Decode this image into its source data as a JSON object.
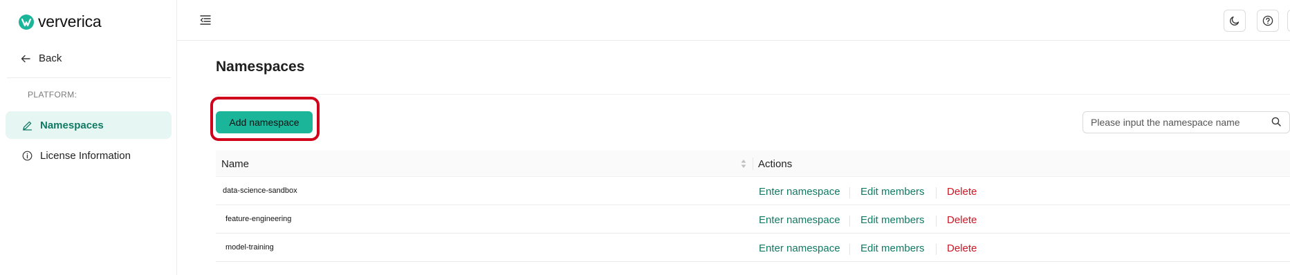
{
  "sidebar": {
    "brand": "ververica",
    "back_label": "Back",
    "section_label": "PLATFORM:",
    "items": [
      {
        "label": "Namespaces",
        "icon": "pencil-icon",
        "active": true
      },
      {
        "label": "License Information",
        "icon": "info-icon",
        "active": false
      }
    ]
  },
  "topbar": {
    "icons": [
      "collapse-menu-icon",
      "moon-icon",
      "help-icon"
    ]
  },
  "main": {
    "title": "Namespaces",
    "add_button_label": "Add namespace",
    "search": {
      "placeholder": "Please input the namespace name"
    },
    "table": {
      "columns": [
        "Name",
        "Actions"
      ],
      "rows": [
        {
          "name": "data-science-sandbox"
        },
        {
          "name": "feature-engineering"
        },
        {
          "name": "model-training"
        }
      ],
      "actions": {
        "enter": "Enter namespace",
        "edit": "Edit members",
        "delete": "Delete"
      }
    }
  },
  "colors": {
    "accent": "#1bb59a",
    "link": "#0f7a64",
    "danger": "#cf1322",
    "highlight": "#d0021b",
    "active_bg": "#e6f6f2"
  }
}
